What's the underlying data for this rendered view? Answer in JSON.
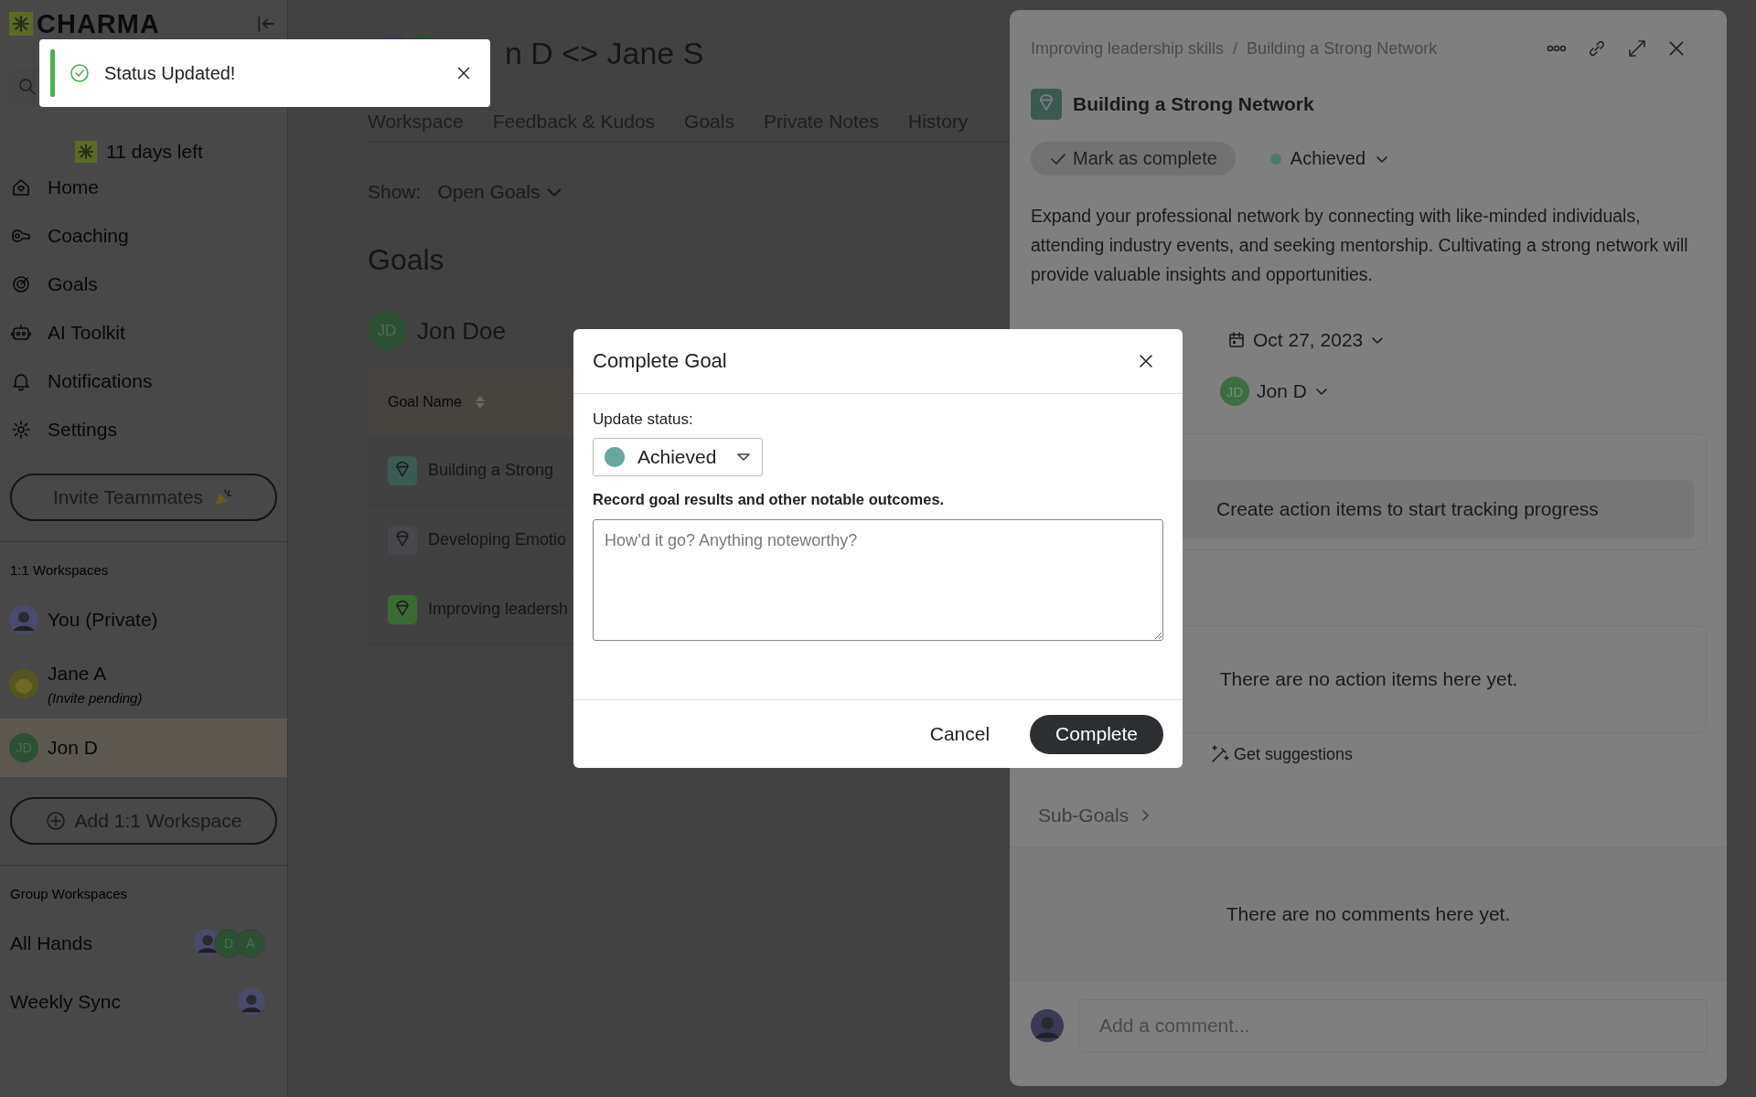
{
  "toast": {
    "message": "Status Updated!"
  },
  "sidebar": {
    "logo": "CHARMA",
    "trial": "11 days left",
    "nav": [
      {
        "label": "Home"
      },
      {
        "label": "Coaching"
      },
      {
        "label": "Goals"
      },
      {
        "label": "AI Toolkit"
      },
      {
        "label": "Notifications"
      },
      {
        "label": "Settings"
      }
    ],
    "invite_button": "Invite Teammates",
    "one_on_one": {
      "heading": "1:1 Workspaces",
      "items": [
        {
          "name": "You (Private)",
          "kind": "photo",
          "selected": false
        },
        {
          "name": "Jane A",
          "note": "(Invite pending)",
          "kind": "cartoon",
          "selected": false
        },
        {
          "name": "Jon D",
          "kind": "initials",
          "initials": "JD",
          "selected": true
        }
      ]
    },
    "add_button": "Add 1:1 Workspace",
    "groups": {
      "heading": "Group Workspaces",
      "items": [
        {
          "name": "All Hands",
          "members": [
            {
              "kind": "photo"
            },
            {
              "kind": "initials",
              "initials": "D"
            },
            {
              "kind": "initials",
              "initials": "A"
            }
          ]
        },
        {
          "name": "Weekly Sync",
          "members": [
            {
              "kind": "photo"
            }
          ]
        }
      ]
    }
  },
  "main": {
    "title": "n D <> Jane S",
    "tabs": [
      {
        "label": "Workspace"
      },
      {
        "label": "Feedback & Kudos"
      },
      {
        "label": "Goals"
      },
      {
        "label": "Private Notes"
      },
      {
        "label": "History"
      }
    ],
    "show_label": "Show:",
    "filter": "Open Goals",
    "heading": "Goals",
    "owner": {
      "initials": "JD",
      "name": "Jon Doe"
    },
    "table": {
      "columns": [
        "Goal Name"
      ],
      "rows": [
        {
          "name": "Building a Strong",
          "color": "#3d5a52"
        },
        {
          "name": "Developing Emotio",
          "color": "#47474d"
        },
        {
          "name": "Improving leadersh",
          "color": "#3b6b35"
        }
      ]
    }
  },
  "panel": {
    "breadcrumb": [
      "Improving leadership skills",
      "Building a Strong Network"
    ],
    "separator": "/",
    "title": "Building a Strong Network",
    "mark_complete": "Mark as complete",
    "status": {
      "label": "Achieved",
      "color": "#4f7b6e"
    },
    "description": "Expand your professional network by connecting with like-minded individuals, attending industry events, and seeking mentorship. Cultivating a strong network will provide valuable insights and opportunities.",
    "due": "Oct 27, 2023",
    "assignee": {
      "initials": "JD",
      "name": "Jon D"
    },
    "action_prompt": "Create action items to start tracking progress",
    "empty_actions": "There are no action items here yet.",
    "suggestions": "Get suggestions",
    "subgoals": "Sub-Goals",
    "empty_comments": "There are no comments here yet.",
    "comment_placeholder": "Add a comment..."
  },
  "modal": {
    "title": "Complete Goal",
    "status_label": "Update status:",
    "status": {
      "label": "Achieved",
      "color": "#6aa6a0"
    },
    "notes_label": "Record goal results and other notable outcomes.",
    "notes_placeholder": "How’d it go? Anything noteworthy?",
    "buttons": [
      {
        "label": "Cancel",
        "kind": "text"
      },
      {
        "label": "Complete",
        "kind": "primary"
      }
    ]
  }
}
